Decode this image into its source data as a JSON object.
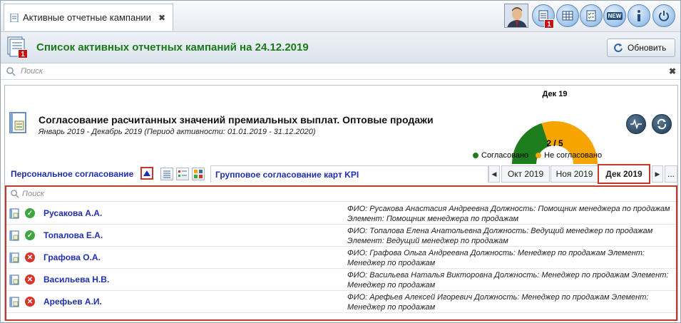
{
  "tab": {
    "title": "Активные отчетные кампании"
  },
  "toolbar": {
    "badge_count": "1",
    "new_label": "NEW"
  },
  "header": {
    "title": "Список активных отчетных кампаний на 24.12.2019",
    "badge_count": "1",
    "refresh_label": "Обновить"
  },
  "search": {
    "placeholder": "Поиск"
  },
  "campaign": {
    "title": "Согласование расчитанных значений премиальных выплат. Оптовые продажи",
    "subtitle": "Январь 2019  - Декабрь 2019 (Период активности: 01.01.2019 - 31.12.2020)"
  },
  "gauge": {
    "period": "Дек 19",
    "value_text": "2 / 5",
    "approved": 2,
    "total": 5,
    "legend": [
      {
        "label": "Согласовано",
        "color": "#1e7e1e"
      },
      {
        "label": "Не согласовано",
        "color": "#f5a400"
      }
    ]
  },
  "tabs": {
    "personal": "Персональное согласование",
    "group": "Групповое согласование карт KPI",
    "months": [
      "Окт 2019",
      "Ноя 2019",
      "Дек 2019"
    ],
    "more": "..."
  },
  "list": {
    "search_placeholder": "Поиск",
    "rows": [
      {
        "name": "Русакова А.А.",
        "status": "approved",
        "details": "ФИО: Русакова Анастасия Андреевна  Должность: Помощник менеджера по продажам Элемент: Помощник менеджера по продажам"
      },
      {
        "name": "Топалова Е.А.",
        "status": "approved",
        "details": "ФИО: Топалова Елена Анатольевна  Должность: Ведущий менеджер по продажам Элемент: Ведущий менеджер по продажам"
      },
      {
        "name": "Графова О.А.",
        "status": "rejected",
        "details": "ФИО: Графова Ольга Андреевна  Должность: Менеджер по продажам  Элемент: Менеджер по продажам"
      },
      {
        "name": "Васильева Н.В.",
        "status": "rejected",
        "details": "ФИО: Васильева Наталья Викторовна  Должность: Менеджер по продажам Элемент: Менеджер по продажам"
      },
      {
        "name": "Арефьев А.И.",
        "status": "rejected",
        "details": "ФИО: Арефьев Алексей Игоревич  Должность: Менеджер по продажам  Элемент: Менеджер по продажам"
      }
    ]
  },
  "colors": {
    "approved": "#3fa63f",
    "rejected": "#d9342b",
    "title_green": "#1a7a1a",
    "link_blue": "#1f2fb0",
    "highlight": "#c0392b"
  }
}
